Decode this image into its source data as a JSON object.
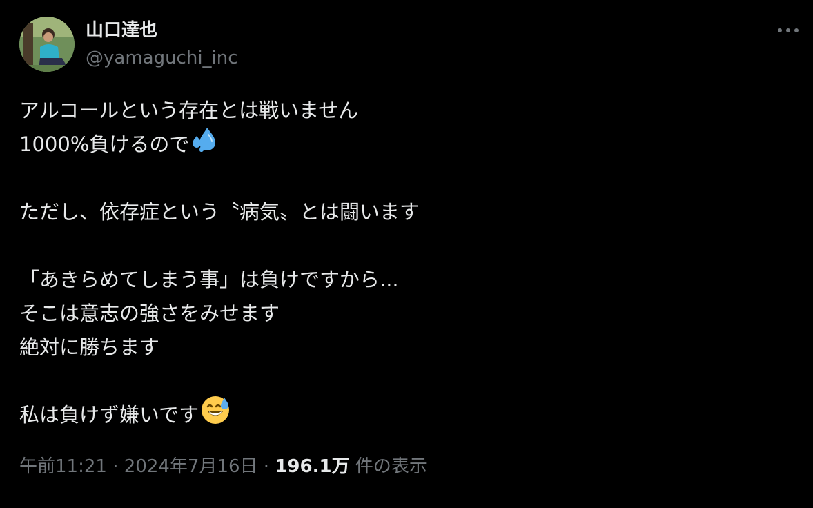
{
  "author": {
    "display_name": "山口達也",
    "handle": "@yamaguchi_inc"
  },
  "post": {
    "lines": [
      "アルコールという存在とは戦いません",
      "1000%負けるので",
      "",
      "ただし、依存症という〝病気〟とは闘います",
      "",
      "「あきらめてしまう事」は負けですから...",
      "そこは意志の強さをみせます",
      "絶対に勝ちます",
      "",
      "私は負けず嫌いです"
    ],
    "emoji_line_2": "sweat-droplets-icon",
    "emoji_line_10": "grinning-sweat-face-icon"
  },
  "meta": {
    "time": "午前11:21",
    "sep1": " · ",
    "date": "2024年7月16日",
    "sep2": " · ",
    "views_count": "196.1万",
    "views_label": " 件の表示"
  },
  "colors": {
    "background": "#000000",
    "text_primary": "#e7e9ea",
    "text_secondary": "#71767b",
    "divider": "#2f3336"
  }
}
